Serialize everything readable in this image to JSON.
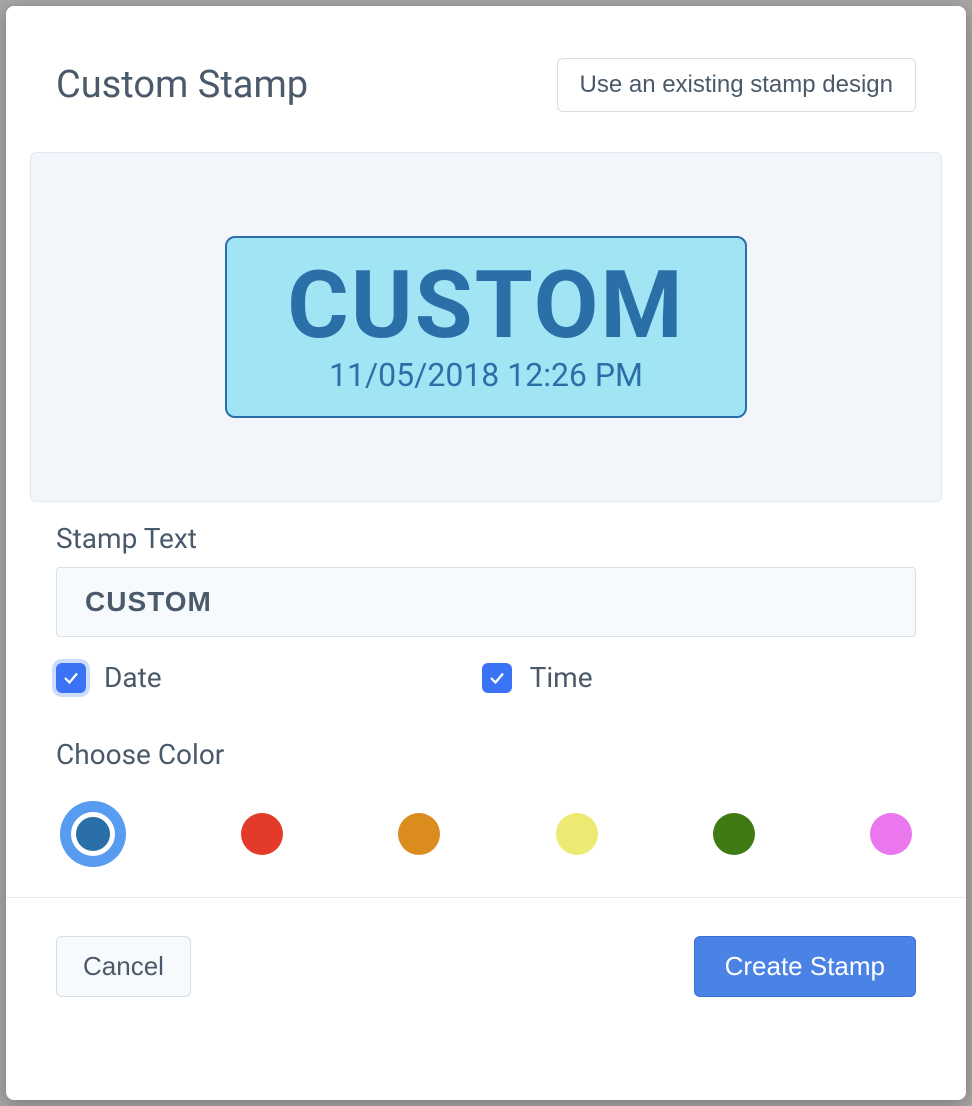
{
  "header": {
    "title": "Custom Stamp",
    "existing_button": "Use an existing stamp design"
  },
  "preview": {
    "text": "CUSTOM",
    "datetime": "11/05/2018 12:26 PM"
  },
  "form": {
    "stamp_text_label": "Stamp Text",
    "stamp_text_value": "CUSTOM",
    "date_label": "Date",
    "date_checked": true,
    "time_label": "Time",
    "time_checked": true,
    "choose_color_label": "Choose Color"
  },
  "colors": {
    "selected": "#2a6fa8",
    "options": [
      "#2a6fa8",
      "#e43a2a",
      "#db8c1f",
      "#edea74",
      "#3f7a13",
      "#ea77ed"
    ]
  },
  "footer": {
    "cancel": "Cancel",
    "create": "Create Stamp"
  }
}
